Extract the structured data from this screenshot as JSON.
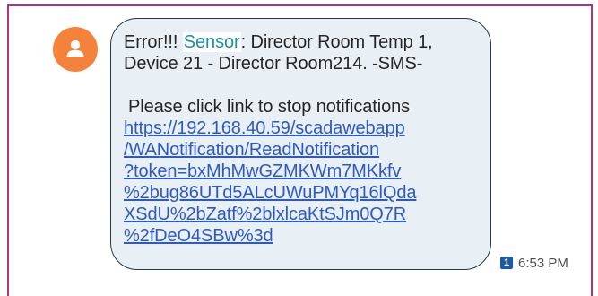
{
  "message": {
    "prefix": "Error!!! ",
    "highlight": "Sensor",
    "line1_rest": ": Director Room Temp 1,",
    "line2": "Device 21 - Director Room214. -SMS-",
    "line3": "Please click link to stop notifications",
    "link_lines": [
      "https://192.168.40.59/scadawebapp",
      "/WANotification/ReadNotification",
      "?token=bxMhMwGZMKWm7MKkfv",
      "%2bug86UTd5ALcUWuPMYq16lQda",
      "XSdU%2bZatf%2blxlcaKtSJm0Q7R",
      "%2fDeO4SBw%3d"
    ]
  },
  "meta": {
    "sim": "1",
    "time": "6:53 PM"
  },
  "colors": {
    "frame_border": "#b2337d",
    "avatar_bg": "#f5823a",
    "bubble_bg": "#e8f0f6",
    "bubble_border": "#253846",
    "highlight_text": "#1f8fa3",
    "link": "#2d59c4",
    "sim_badge": "#1b5aa9"
  },
  "icons": {
    "avatar": "person-icon",
    "sim": "sim-1-icon"
  }
}
